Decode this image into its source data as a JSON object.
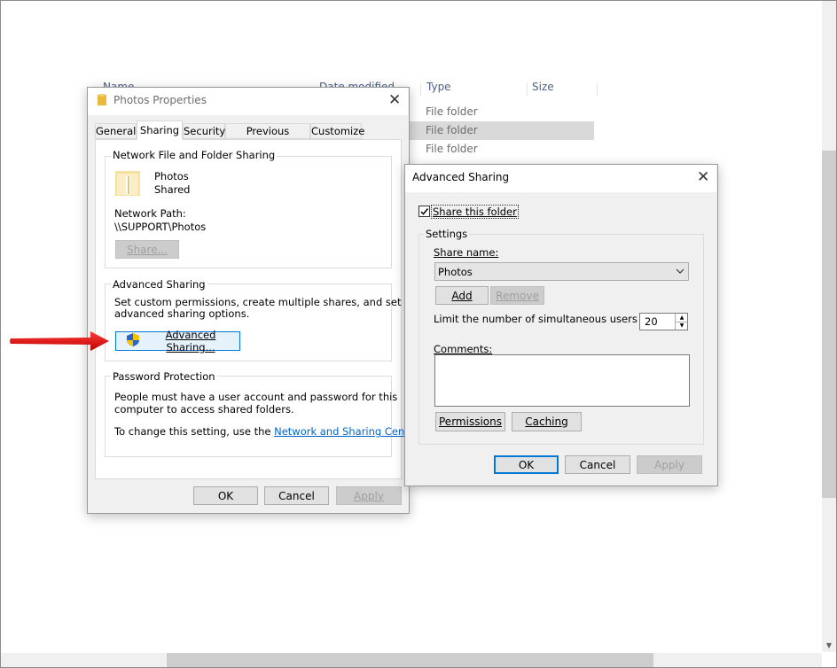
{
  "explorer": {
    "columns": [
      "Name",
      "Date modified",
      "Type",
      "Size"
    ],
    "rows": [
      {
        "type": "File folder"
      },
      {
        "type": "File folder"
      },
      {
        "type": "File folder"
      }
    ]
  },
  "props": {
    "title": "Photos Properties",
    "tabs": [
      "General",
      "Sharing",
      "Security",
      "Previous Versions",
      "Customize"
    ],
    "network_group": "Network File and Folder Sharing",
    "folder_name": "Photos",
    "folder_status": "Shared",
    "network_path_label": "Network Path:",
    "network_path": "\\\\SUPPORT\\Photos",
    "share_btn": "Share...",
    "adv_group": "Advanced Sharing",
    "adv_desc_1": "Set custom permissions, create multiple shares, and set other",
    "adv_desc_2": "advanced sharing options.",
    "adv_btn": "Advanced Sharing...",
    "pwd_group": "Password Protection",
    "pwd_desc_1": "People must have a user account and password for this",
    "pwd_desc_2": "computer to access shared folders.",
    "pwd_change": "To change this setting, use the",
    "pwd_link": "Network and Sharing Center",
    "pwd_period": ".",
    "ok": "OK",
    "cancel": "Cancel",
    "apply": "Apply"
  },
  "adv": {
    "title": "Advanced Sharing",
    "share_checkbox": "Share this folder",
    "settings_group": "Settings",
    "share_name_label": "Share name:",
    "share_name_value": "Photos",
    "add": "Add",
    "remove": "Remove",
    "limit_label": "Limit the number of simultaneous users to:",
    "limit_value": "20",
    "comments_label": "Comments:",
    "permissions": "Permissions",
    "caching": "Caching",
    "ok": "OK",
    "cancel": "Cancel",
    "apply": "Apply"
  },
  "colors": {
    "accent": "#0078d7",
    "arrow": "#e00000",
    "link": "#0066cc"
  }
}
